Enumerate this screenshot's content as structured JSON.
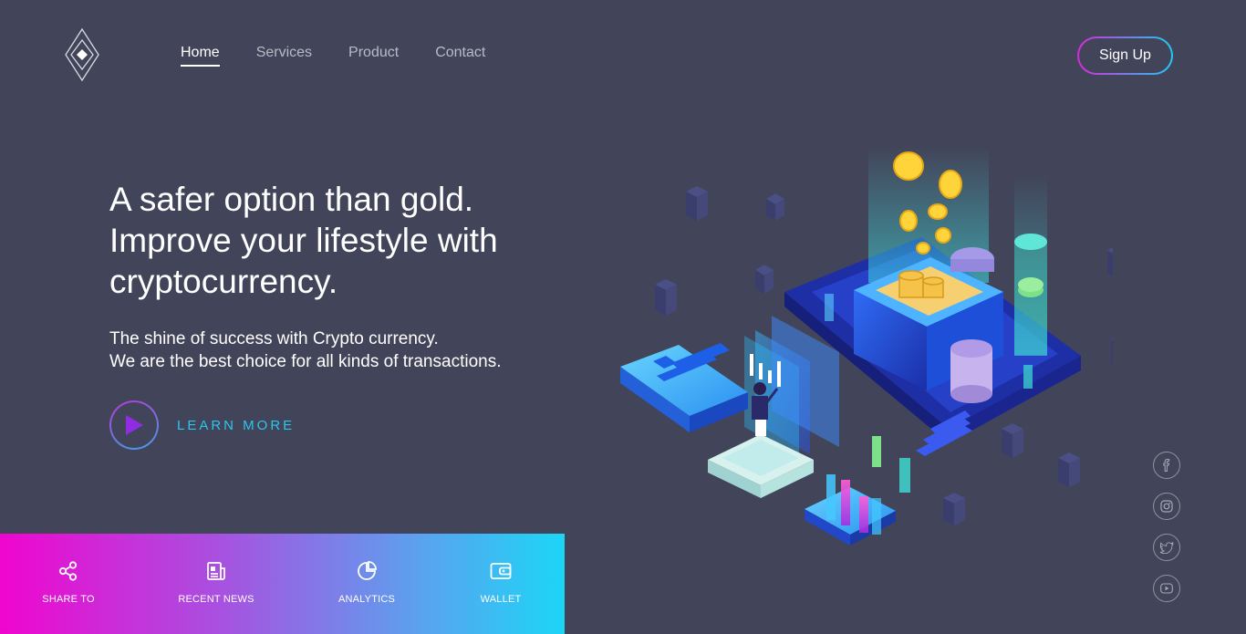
{
  "nav": {
    "items": [
      {
        "label": "Home",
        "active": true
      },
      {
        "label": "Services"
      },
      {
        "label": "Product"
      },
      {
        "label": "Contact"
      }
    ],
    "signup_label": "Sign Up"
  },
  "hero": {
    "headline_lines": [
      "A safer option than gold.",
      "Improve your lifestyle with",
      "cryptocurrency."
    ],
    "subline_lines": [
      "The shine of success with Crypto currency.",
      "We are the best choice for all kinds of transactions."
    ],
    "cta_label": "LEARN MORE"
  },
  "bottom_bar": {
    "items": [
      {
        "label": "SHARE TO",
        "icon": "share-icon"
      },
      {
        "label": "RECENT NEWS",
        "icon": "news-icon"
      },
      {
        "label": "ANALYTICS",
        "icon": "pie-chart-icon"
      },
      {
        "label": "WALLET",
        "icon": "wallet-icon"
      }
    ]
  },
  "social": [
    "facebook-icon",
    "instagram-icon",
    "twitter-icon",
    "youtube-icon"
  ],
  "colors": {
    "background": "#424459",
    "accent_cyan": "#2bc6ef",
    "accent_magenta": "#f005cf",
    "play_triangle": "#8e2de2"
  }
}
